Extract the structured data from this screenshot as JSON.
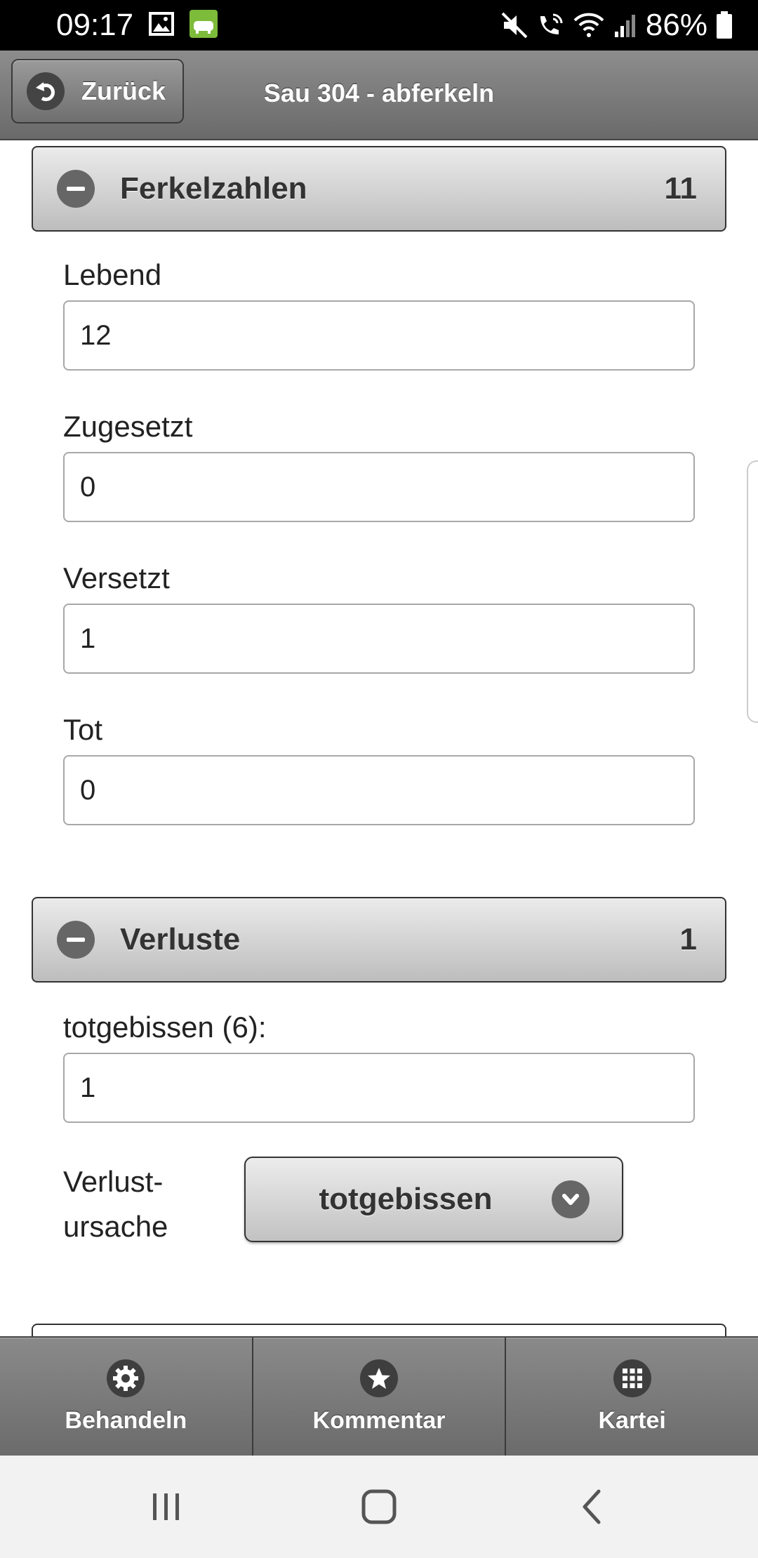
{
  "status_bar": {
    "time": "09:17",
    "battery_percent": "86%"
  },
  "header": {
    "back_label": "Zurück",
    "title": "Sau 304 - abferkeln"
  },
  "sections": {
    "ferkelzahlen": {
      "title": "Ferkelzahlen",
      "count": "11",
      "fields": [
        {
          "label": "Lebend",
          "value": "12"
        },
        {
          "label": "Zugesetzt",
          "value": "0"
        },
        {
          "label": "Versetzt",
          "value": "1"
        },
        {
          "label": "Tot",
          "value": "0"
        }
      ]
    },
    "verluste": {
      "title": "Verluste",
      "count": "1",
      "field_label": "totgebissen (6):",
      "field_value": "1",
      "cause_label_line1": "Verlust-",
      "cause_label_line2": "ursache",
      "cause_value": "totgebissen"
    }
  },
  "navbar": {
    "items": [
      {
        "label": "Behandeln",
        "icon": "gear-icon"
      },
      {
        "label": "Kommentar",
        "icon": "star-icon"
      },
      {
        "label": "Kartei",
        "icon": "grid-icon"
      }
    ]
  }
}
